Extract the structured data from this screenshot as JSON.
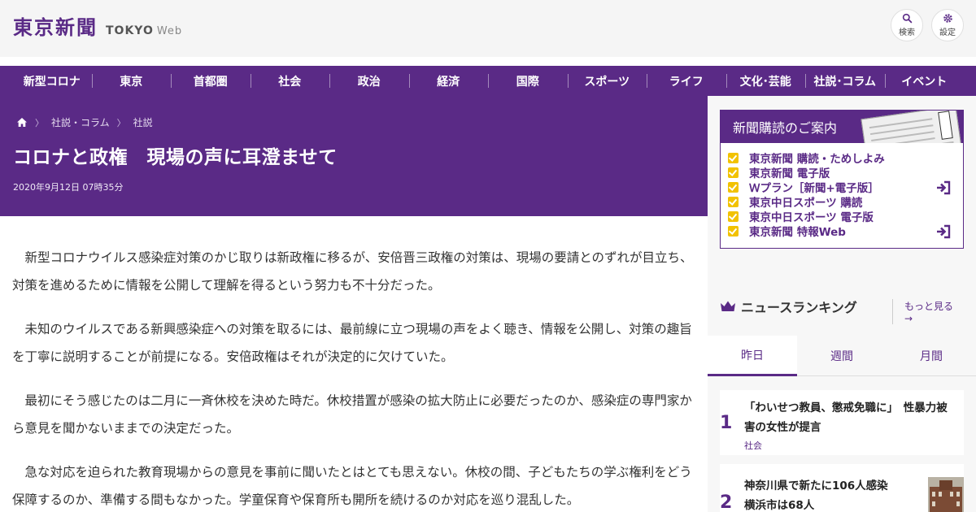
{
  "header": {
    "logo_jp": "東京新聞",
    "logo_en": "TOKYO",
    "logo_web": "Web",
    "search_label": "検索",
    "settings_label": "設定"
  },
  "nav": [
    "新型コロナ",
    "東京",
    "首都圏",
    "社会",
    "政治",
    "経済",
    "国際",
    "スポーツ",
    "ライフ",
    "文化･芸能",
    "社説･コラム",
    "イベント"
  ],
  "breadcrumb": [
    "社説・コラム",
    "社説"
  ],
  "article": {
    "title": "コロナと政権　現場の声に耳澄ませて",
    "date": "2020年9月12日 07時35分",
    "paragraphs": [
      "新型コロナウイルス感染症対策のかじ取りは新政権に移るが、安倍晋三政権の対策は、現場の要請とのずれが目立ち、対策を進めるために情報を公開して理解を得るという努力も不十分だった。",
      "未知のウイルスである新興感染症への対策を取るには、最前線に立つ現場の声をよく聴き、情報を公開し、対策の趣旨を丁寧に説明することが前提になる。安倍政権はそれが決定的に欠けていた。",
      "最初にそう感じたのは二月に一斉休校を決めた時だ。休校措置が感染の拡大防止に必要だったのか、感染症の専門家から意見を聞かないままでの決定だった。",
      "急な対応を迫られた教育現場からの意見を事前に聞いたとはとても思えない。休校の間、子どもたちの学ぶ権利をどう保障するのか、準備する間もなかった。学童保育や保育所も開所を続けるのか対応を巡り混乱した。"
    ]
  },
  "subscribe": {
    "title": "新聞購読のご案内",
    "items": [
      "東京新聞 購読・ためしよみ",
      "東京新聞 電子版",
      "Ｗプラン［新聞+電子版］",
      "東京中日スポーツ 購読",
      "東京中日スポーツ 電子版",
      "東京新聞 特報Web"
    ]
  },
  "ranking": {
    "title": "ニュースランキング",
    "more": "もっと見る",
    "tabs": [
      "昨日",
      "週間",
      "月間"
    ],
    "items": [
      {
        "rank": "1",
        "title_line1": "「わいせつ教員、懲戒免職に」　性暴力被",
        "title_line2": "害の女性が提言",
        "category": "社会"
      },
      {
        "rank": "2",
        "title_line1": "神奈川県で新たに106人感染",
        "title_line2": "横浜市は68人",
        "category": ""
      }
    ]
  },
  "colors": {
    "brand": "#5a2a86",
    "accent": "#f2c200"
  }
}
